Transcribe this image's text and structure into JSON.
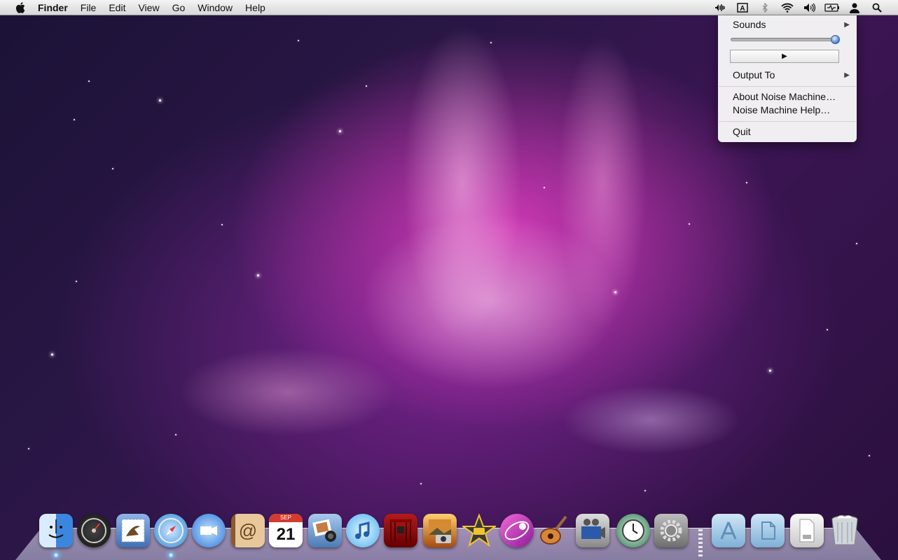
{
  "menubar": {
    "apple_glyph": "",
    "app_name": "Finder",
    "menus": [
      "File",
      "Edit",
      "View",
      "Go",
      "Window",
      "Help"
    ],
    "status_icons": [
      "noise-machine-icon",
      "keyboard-input-icon",
      "bluetooth-icon",
      "wifi-icon",
      "volume-icon",
      "battery-icon",
      "user-icon",
      "spotlight-search-icon"
    ]
  },
  "dropdown": {
    "sounds_label": "Sounds",
    "play_glyph": "▶",
    "output_label": "Output To",
    "about_label": "About Noise Machine…",
    "help_label": "Noise Machine Help…",
    "quit_label": "Quit",
    "submenu_arrow": "▶",
    "volume_level": 0.98
  },
  "dock": {
    "apps": [
      {
        "name": "finder-icon"
      },
      {
        "name": "dashboard-icon"
      },
      {
        "name": "mail-icon"
      },
      {
        "name": "safari-icon"
      },
      {
        "name": "ichat-icon"
      },
      {
        "name": "address-book-icon"
      },
      {
        "name": "ical-icon",
        "cal_month": "SEP",
        "cal_day": "21"
      },
      {
        "name": "iphoto-icon"
      },
      {
        "name": "itunes-icon"
      },
      {
        "name": "front-row-icon"
      },
      {
        "name": "photo-booth-icon"
      },
      {
        "name": "imovie-icon"
      },
      {
        "name": "vitamin-r-icon"
      },
      {
        "name": "garageband-icon"
      },
      {
        "name": "dvd-player-icon"
      },
      {
        "name": "time-machine-icon"
      },
      {
        "name": "system-preferences-icon"
      }
    ],
    "stacks": [
      {
        "name": "applications-folder-icon"
      },
      {
        "name": "documents-folder-icon"
      },
      {
        "name": "downloads-icon"
      },
      {
        "name": "trash-icon"
      }
    ]
  }
}
